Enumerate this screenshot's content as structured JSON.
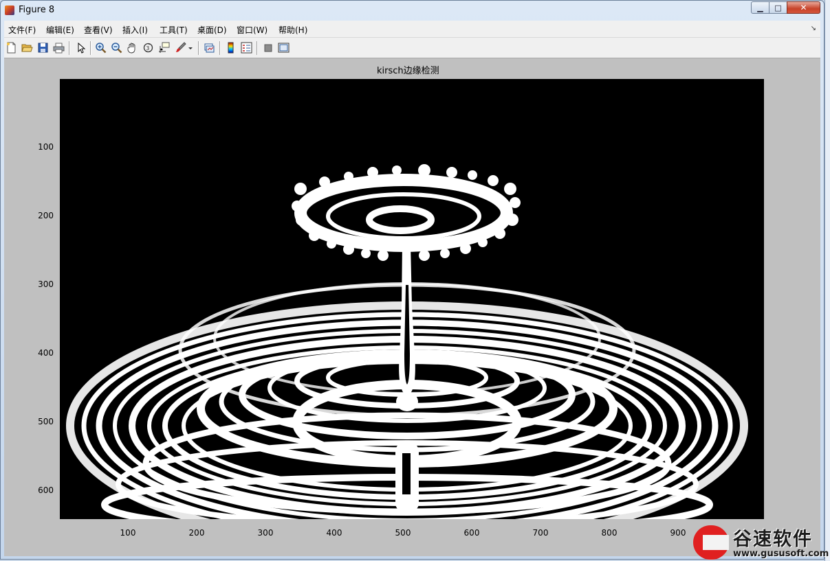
{
  "window": {
    "title": "Figure 8",
    "minimize_label": "▁",
    "maximize_label": "□",
    "close_label": "✕"
  },
  "menu": {
    "items": [
      "文件(F)",
      "编辑(E)",
      "查看(V)",
      "插入(I)",
      "工具(T)",
      "桌面(D)",
      "窗口(W)",
      "帮助(H)"
    ],
    "overflow": "↘"
  },
  "toolbar": {
    "icons": [
      "new-figure-icon",
      "open-file-icon",
      "save-icon",
      "print-icon",
      "edit-plot-arrow-icon",
      "zoom-in-icon",
      "zoom-out-icon",
      "pan-hand-icon",
      "rotate-3d-icon",
      "data-cursor-icon",
      "brush-icon",
      "brush-dropdown-icon",
      "link-plot-icon",
      "colorbar-icon",
      "legend-icon",
      "hide-plot-tools-icon",
      "show-plot-tools-icon"
    ]
  },
  "figure": {
    "title": "kirsch边缘检测",
    "y_ticks": [
      "100",
      "200",
      "300",
      "400",
      "500",
      "600"
    ],
    "x_ticks": [
      "100",
      "200",
      "300",
      "400",
      "500",
      "600",
      "700",
      "800",
      "900"
    ]
  },
  "watermark": {
    "brand": "谷速软件",
    "url": "www.gususoft.com"
  },
  "colors": {
    "background": "#000000",
    "edges": "#ffffff",
    "close_button": "#c7432a"
  }
}
